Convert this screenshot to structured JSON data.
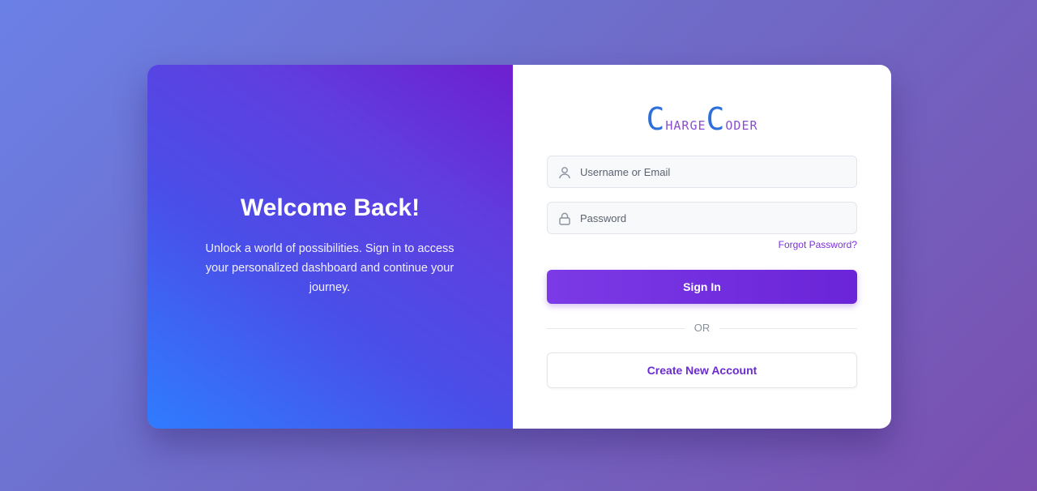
{
  "welcome": {
    "title": "Welcome Back!",
    "text": "Unlock a world of possibilities. Sign in to access your personalized dashboard and continue your journey."
  },
  "logo": {
    "first_initial": "C",
    "first_rest": "HARGE",
    "second_initial": "C",
    "second_rest": "ODER"
  },
  "form": {
    "username_placeholder": "Username or Email",
    "password_placeholder": "Password",
    "forgot_label": "Forgot Password?",
    "signin_label": "Sign In",
    "divider_label": "OR",
    "create_label": "Create New Account"
  },
  "icons": {
    "username": "user-icon",
    "password": "lock-icon"
  },
  "colors": {
    "accent": "#7b3ae6",
    "logo_blue": "#2f6fdc",
    "logo_purple": "#8a4fcf"
  }
}
